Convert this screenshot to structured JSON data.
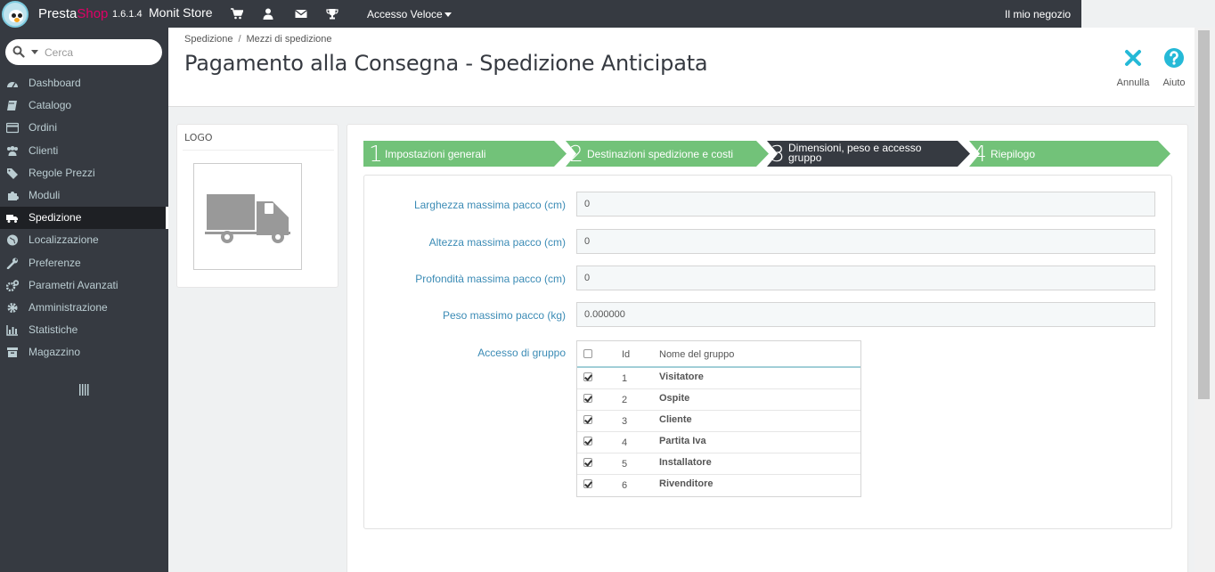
{
  "topbar": {
    "brand_presta": "Presta",
    "brand_shop": "Shop",
    "version": "1.6.1.4",
    "store_name": "Monit Store",
    "icons": [
      "cart-icon",
      "user-icon",
      "envelope-icon",
      "trophy-icon"
    ],
    "quick_access": "Accesso Veloce",
    "my_store": "Il mio negozio"
  },
  "sidebar": {
    "search_placeholder": "Cerca",
    "items": [
      {
        "label": "Dashboard",
        "icon": "dashboard-icon"
      },
      {
        "label": "Catalogo",
        "icon": "book-icon"
      },
      {
        "label": "Ordini",
        "icon": "credit-card-icon"
      },
      {
        "label": "Clienti",
        "icon": "users-icon"
      },
      {
        "label": "Regole Prezzi",
        "icon": "tags-icon"
      },
      {
        "label": "Moduli",
        "icon": "puzzle-icon"
      },
      {
        "label": "Spedizione",
        "icon": "truck-icon",
        "active": true
      },
      {
        "label": "Localizzazione",
        "icon": "globe-icon"
      },
      {
        "label": "Preferenze",
        "icon": "wrench-icon"
      },
      {
        "label": "Parametri Avanzati",
        "icon": "cogs-icon"
      },
      {
        "label": "Amministrazione",
        "icon": "cog-icon"
      },
      {
        "label": "Statistiche",
        "icon": "bar-chart-icon"
      },
      {
        "label": "Magazzino",
        "icon": "archive-icon"
      }
    ]
  },
  "header": {
    "breadcrumb": [
      "Spedizione",
      "Mezzi di spedizione"
    ],
    "title": "Pagamento alla Consegna - Spedizione Anticipata",
    "cancel_label": "Annulla",
    "help_label": "Aiuto"
  },
  "logo_panel": {
    "title": "LOGO"
  },
  "wizard": {
    "steps": [
      {
        "num": "1",
        "label": "Impostazioni generali",
        "state": "done"
      },
      {
        "num": "2",
        "label": "Destinazioni spedizione e costi",
        "state": "done"
      },
      {
        "num": "3",
        "label": "Dimensioni, peso e accesso gruppo",
        "state": "current"
      },
      {
        "num": "4",
        "label": "Riepilogo",
        "state": "todo"
      }
    ]
  },
  "form": {
    "fields": [
      {
        "label": "Larghezza massima pacco (cm)",
        "value": "0"
      },
      {
        "label": "Altezza massima pacco (cm)",
        "value": "0"
      },
      {
        "label": "Profondità massima pacco (cm)",
        "value": "0"
      },
      {
        "label": "Peso massimo pacco (kg)",
        "value": "0.000000"
      }
    ],
    "group_access_label": "Accesso di gruppo",
    "group_table": {
      "headers": {
        "id": "Id",
        "name": "Nome del gruppo"
      },
      "header_checked": false,
      "rows": [
        {
          "id": "1",
          "name": "Visitatore",
          "checked": true
        },
        {
          "id": "2",
          "name": "Ospite",
          "checked": true
        },
        {
          "id": "3",
          "name": "Cliente",
          "checked": true
        },
        {
          "id": "4",
          "name": "Partita Iva",
          "checked": true
        },
        {
          "id": "5",
          "name": "Installatore",
          "checked": true
        },
        {
          "id": "6",
          "name": "Rivenditore",
          "checked": true
        }
      ]
    }
  },
  "colors": {
    "step_done": "#72c279",
    "step_current": "#363a41",
    "accent": "#25b9d7",
    "label_blue": "#3b8bb5"
  }
}
